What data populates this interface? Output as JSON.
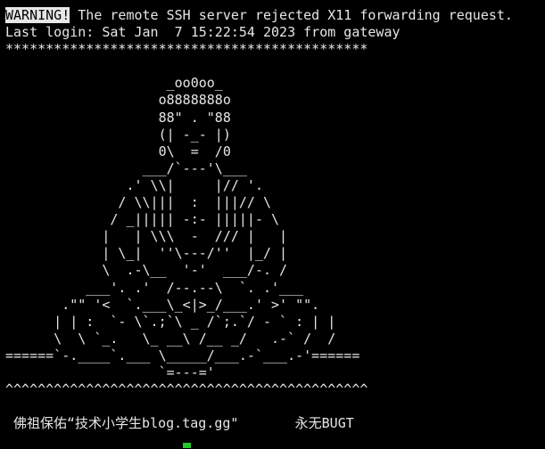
{
  "terminal": {
    "warning_tag": "WARNING!",
    "warning_text": " The remote SSH server rejected X11 forwarding request.",
    "last_login": "Last login: Sat Jan  7 15:22:54 2023 from gateway",
    "stars": "*********************************************"
  },
  "banner": {
    "art": [
      "                    _oo0oo_",
      "                   o8888888o",
      "                   88\" . \"88",
      "                   (| -_- |)",
      "                   0\\  =  /0",
      "                 ___/`---'\\___",
      "               .' \\\\|     |// '.",
      "              / \\\\|||  :  |||// \\",
      "             / _||||| -:- |||||- \\",
      "            |   | \\\\\\  -  /// |   |",
      "            | \\_|  ''\\---/''  |_/ |",
      "            \\  .-\\__  '-'  ___/-. /",
      "          ___'. .'  /--.--\\  `. .'___",
      "       .\"\" '<  `.___\\_<|>_/___.' >' \"\".",
      "      | | :  `- \\`.;`\\ _ /`;.`/ - ` : | |",
      "      \\  \\ `_.   \\_ __\\ /__ _/   .-` /  /",
      "======`-.____`.___ \\_____/___.-`___.-'======",
      "                   `=---='",
      "^^^^^^^^^^^^^^^^^^^^^^^^^^^^^^^^^^^^^^^^^^^^^"
    ],
    "blessing": " 佛祖保佑“技术小学生blog.tag.gg\"       永无BUGT"
  },
  "colors": {
    "background": "#000000",
    "foreground": "#e6e6e6",
    "cursor": "#22c72c"
  }
}
